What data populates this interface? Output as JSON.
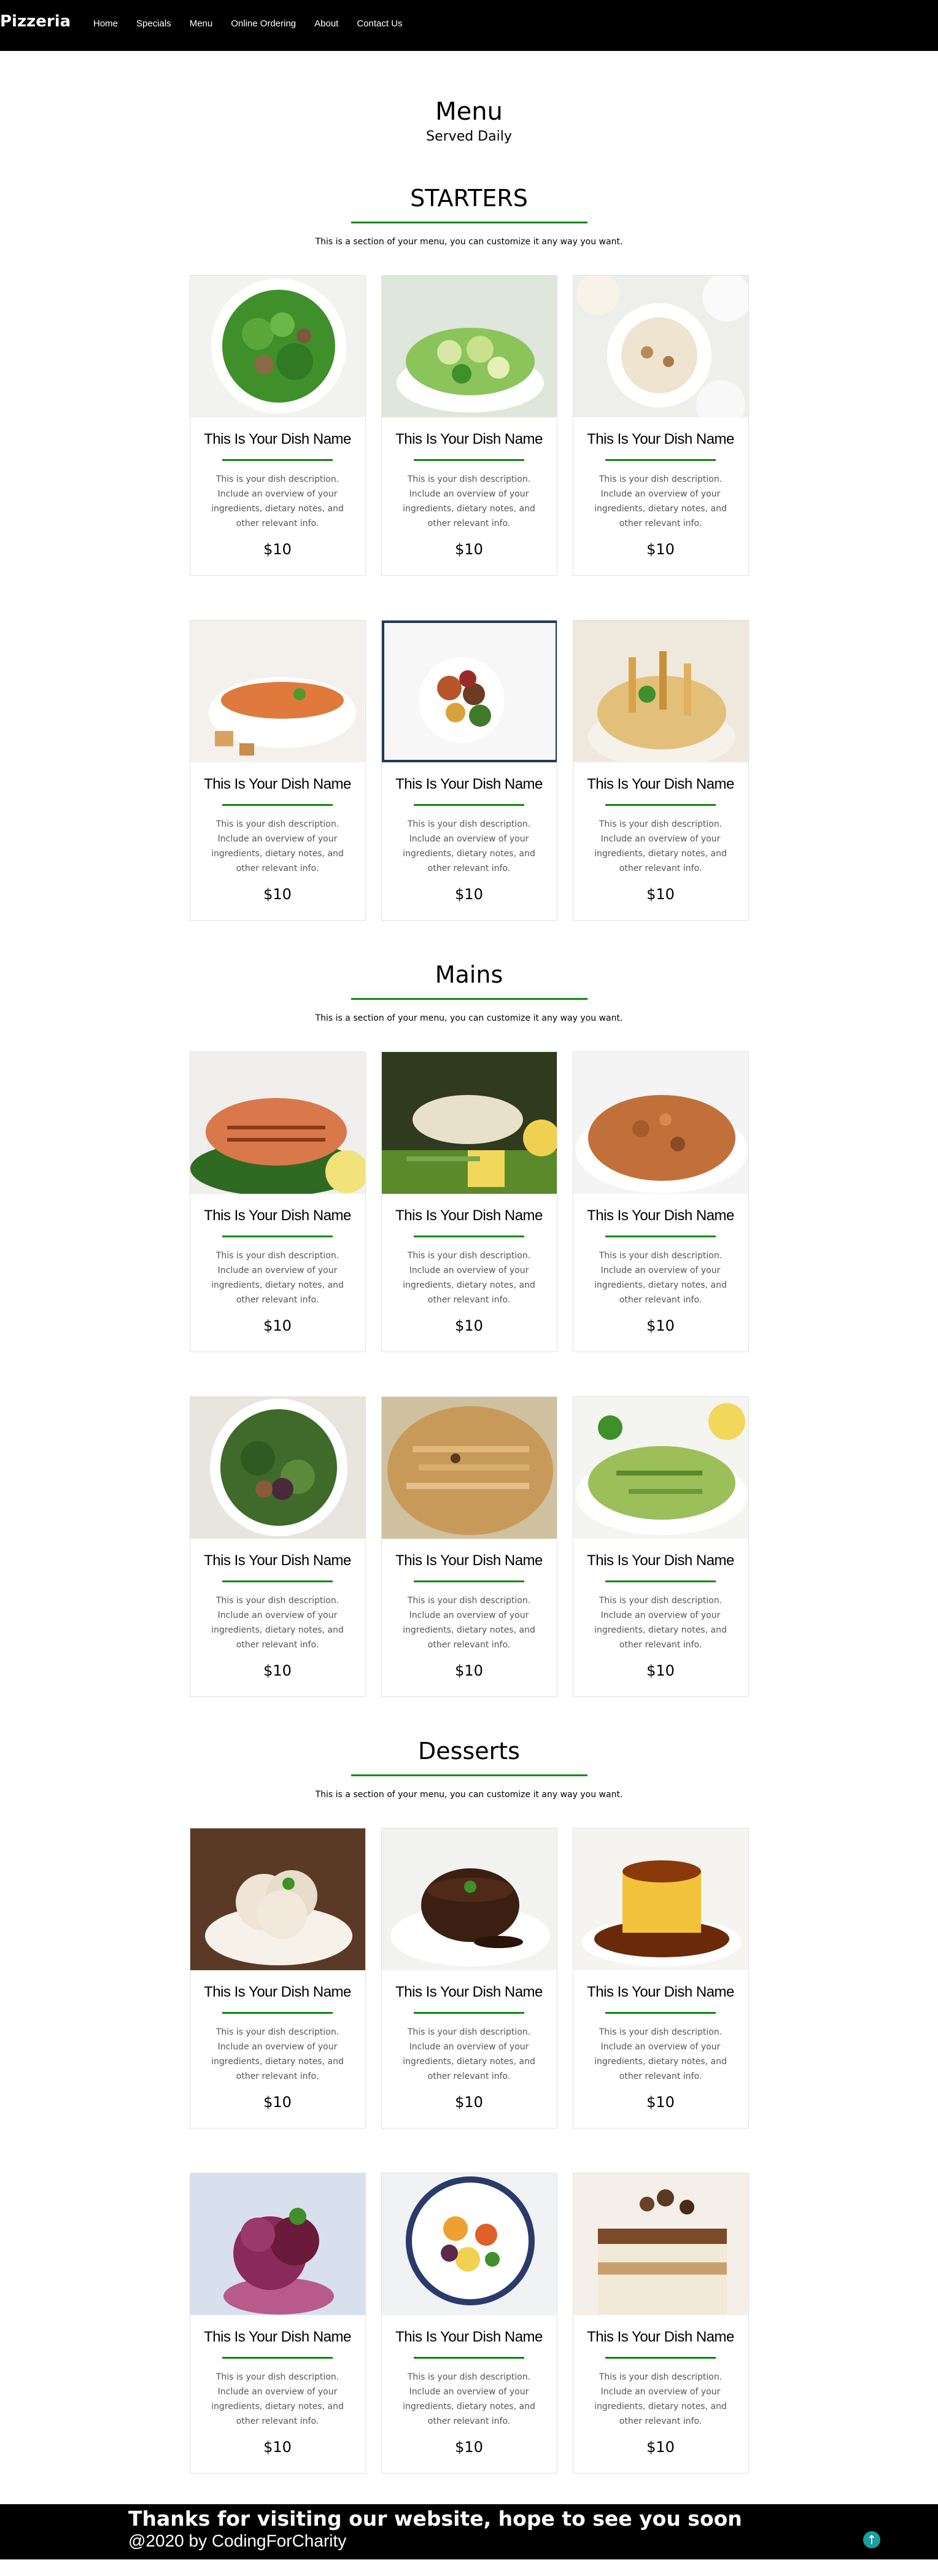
{
  "nav": {
    "brand": "Pizzeria",
    "links": [
      "Home",
      "Specials",
      "Menu",
      "Online Ordering",
      "About",
      "Contact Us"
    ]
  },
  "menu": {
    "title": "Menu",
    "subtitle": "Served Daily"
  },
  "sections": [
    {
      "title": "STARTERS",
      "desc": "This is a section of your menu, you can customize it any way you want."
    },
    {
      "title": "Mains",
      "desc": "This is a section of your menu, you can customize it any way you want."
    },
    {
      "title": "Desserts",
      "desc": "This is a section of your menu, you can customize it any way you want."
    }
  ],
  "dish": {
    "name": "This Is Your Dish Name",
    "desc": "This is your dish description. Include an overview of your ingredients, dietary notes, and other relevant info.",
    "price": "$10"
  },
  "images": {
    "starters": [
      "spinach-salad",
      "cucumber-salad",
      "cream-soup",
      "tomato-soup",
      "grilled-vegetables",
      "fries-bowl"
    ],
    "mains": [
      "salmon-fillet",
      "fish-with-potato",
      "rice-dish",
      "spinach-salad-plate",
      "fettuccine",
      "pesto-pasta"
    ],
    "desserts": [
      "ice-cream",
      "chocolate-lava-cake",
      "flan",
      "berry-sorbet",
      "fruit-bowl",
      "tiramisu"
    ]
  },
  "colors": {
    "accent": "#0b8a0b",
    "navbar": "#000000",
    "footer": "#000000",
    "to_top": "#1e9e9e"
  },
  "footer": {
    "thanks": "Thanks for visiting our website, hope to see you soon",
    "copyright": "@2020 by CodingForCharity",
    "to_top_icon": "arrow-up-icon"
  }
}
